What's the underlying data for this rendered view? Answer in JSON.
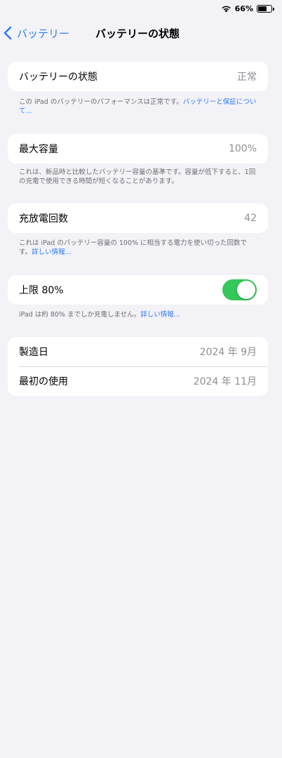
{
  "status_bar": {
    "battery_percent": "66%",
    "battery_level": 0.66
  },
  "nav": {
    "back_label": "バッテリー",
    "title": "バッテリーの状態"
  },
  "battery_health": {
    "label": "バッテリーの状態",
    "value": "正常",
    "footnote_text": "この iPad のバッテリーのパフォーマンスは正常です。",
    "footnote_link": "バッテリーと保証について..."
  },
  "max_capacity": {
    "label": "最大容量",
    "value": "100%",
    "footnote_text": "これは、新品時と比較したバッテリー容量の基準です。容量が低下すると、1回の充電で使用できる時間が短くなることがあります。"
  },
  "cycle_count": {
    "label": "充放電回数",
    "value": "42",
    "footnote_text": "これは iPad のバッテリー容量の 100% に相当する電力を使い切った回数です。",
    "footnote_link": "詳しい情報..."
  },
  "limit": {
    "label": "上限 80%",
    "toggle_on": true,
    "toggle_color": "#34c759",
    "footnote_text": "iPad は約 80% までしか充電しません。",
    "footnote_link": "詳しい情報..."
  },
  "info": {
    "manufacture_label": "製造日",
    "manufacture_value": "2024 年 9月",
    "first_use_label": "最初の使用",
    "first_use_value": "2024 年 11月"
  },
  "colors": {
    "accent": "#2f7bf5",
    "background": "#f2f2f7"
  }
}
